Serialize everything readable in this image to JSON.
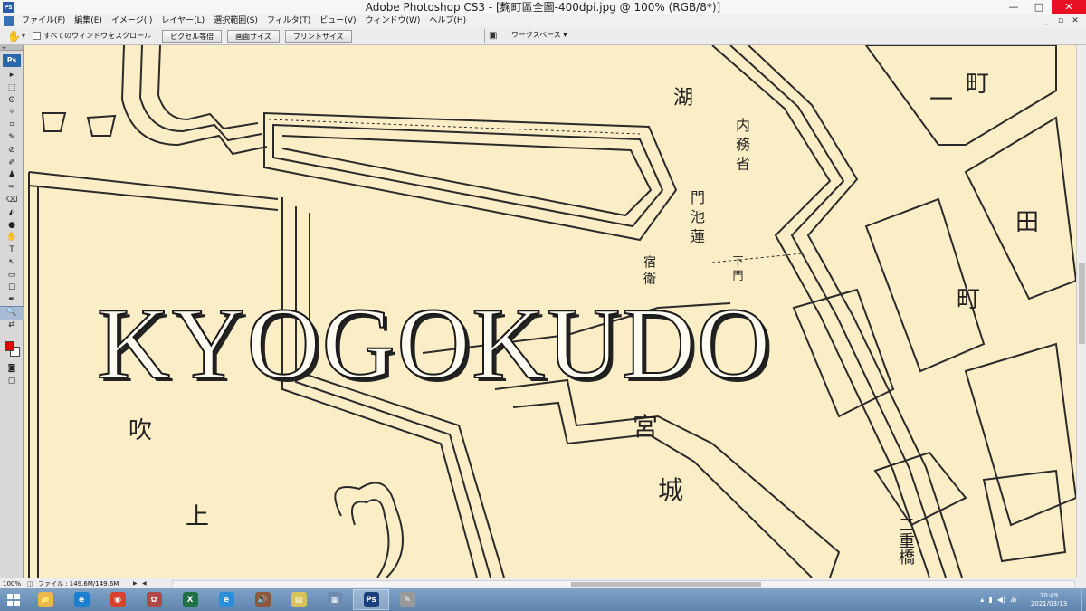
{
  "window": {
    "title": "Adobe Photoshop CS3 - [麹町區全圖-400dpi.jpg @ 100% (RGB/8*)]",
    "app_icon_text": "Ps",
    "minimize": "—",
    "maximize": "□",
    "close": "✕"
  },
  "menu": {
    "items": [
      "ファイル(F)",
      "編集(E)",
      "イメージ(I)",
      "レイヤー(L)",
      "選択範囲(S)",
      "フィルタ(T)",
      "ビュー(V)",
      "ウィンドウ(W)",
      "ヘルプ(H)"
    ],
    "doc_minimize": "_",
    "doc_restore": "▫",
    "doc_close": "✕"
  },
  "options": {
    "scroll_all_label": "すべてのウィンドウをスクロール",
    "actual_pixels": "ピクセル等倍",
    "fit_screen": "画面サイズ",
    "print_size": "プリントサイズ",
    "workspace": "ワークスペース ▾"
  },
  "toolbox": {
    "logo": "Ps",
    "tools": [
      "▸",
      "⬚",
      "ʘ",
      "✧",
      "⌗",
      "✎",
      "⊘",
      "✐",
      "♟",
      "✑",
      "⌫",
      "◭",
      "●",
      "✋",
      "T",
      "↖",
      "▭",
      "☐",
      "✒",
      "🔍",
      "⇄"
    ],
    "active_index": 19,
    "foreground_color": "#dd0000",
    "background_color": "#ffffff"
  },
  "canvas": {
    "watermark": "KYOGOKUDO",
    "labels": [
      {
        "text": "湖",
        "name": "map-label-1"
      },
      {
        "text": "吹",
        "name": "map-label-2"
      },
      {
        "text": "上",
        "name": "map-label-3"
      },
      {
        "text": "宮",
        "name": "map-label-4"
      },
      {
        "text": "城",
        "name": "map-label-5"
      },
      {
        "text": "町",
        "name": "map-label-6"
      },
      {
        "text": "一",
        "name": "map-label-7"
      },
      {
        "text": "町",
        "name": "map-label-8"
      },
      {
        "text": "田",
        "name": "map-label-9"
      },
      {
        "text": "二重橋",
        "name": "map-label-10"
      },
      {
        "text": "内 務 省",
        "name": "map-label-11"
      },
      {
        "text": "門 池 蓮",
        "name": "map-label-12"
      },
      {
        "text": "宿 衛",
        "name": "map-label-13"
      },
      {
        "text": "下 門",
        "name": "map-label-14"
      }
    ]
  },
  "status": {
    "zoom": "100%",
    "file_info": "ファイル : 149.6M/149.6M"
  },
  "taskbar": {
    "apps": [
      {
        "name": "explorer",
        "glyph": "📁",
        "color": "#e9b84a"
      },
      {
        "name": "ie",
        "glyph": "e",
        "color": "#1d7fd1"
      },
      {
        "name": "chrome",
        "glyph": "◉",
        "color": "#d9412f"
      },
      {
        "name": "paint",
        "glyph": "✿",
        "color": "#b04a4a"
      },
      {
        "name": "excel",
        "glyph": "X",
        "color": "#1e7145"
      },
      {
        "name": "edge",
        "glyph": "e",
        "color": "#2a8fd8"
      },
      {
        "name": "volume",
        "glyph": "🔊",
        "color": "#8c5a3a"
      },
      {
        "name": "folder",
        "glyph": "▤",
        "color": "#d8c15a"
      },
      {
        "name": "notepad",
        "glyph": "▦",
        "color": "#6c8cb0"
      },
      {
        "name": "photoshop",
        "glyph": "Ps",
        "color": "#1b3f7a"
      },
      {
        "name": "misc",
        "glyph": "✎",
        "color": "#9a9a9a"
      }
    ],
    "active_app": "photoshop",
    "time": "20:49",
    "date": "2021/03/13"
  }
}
